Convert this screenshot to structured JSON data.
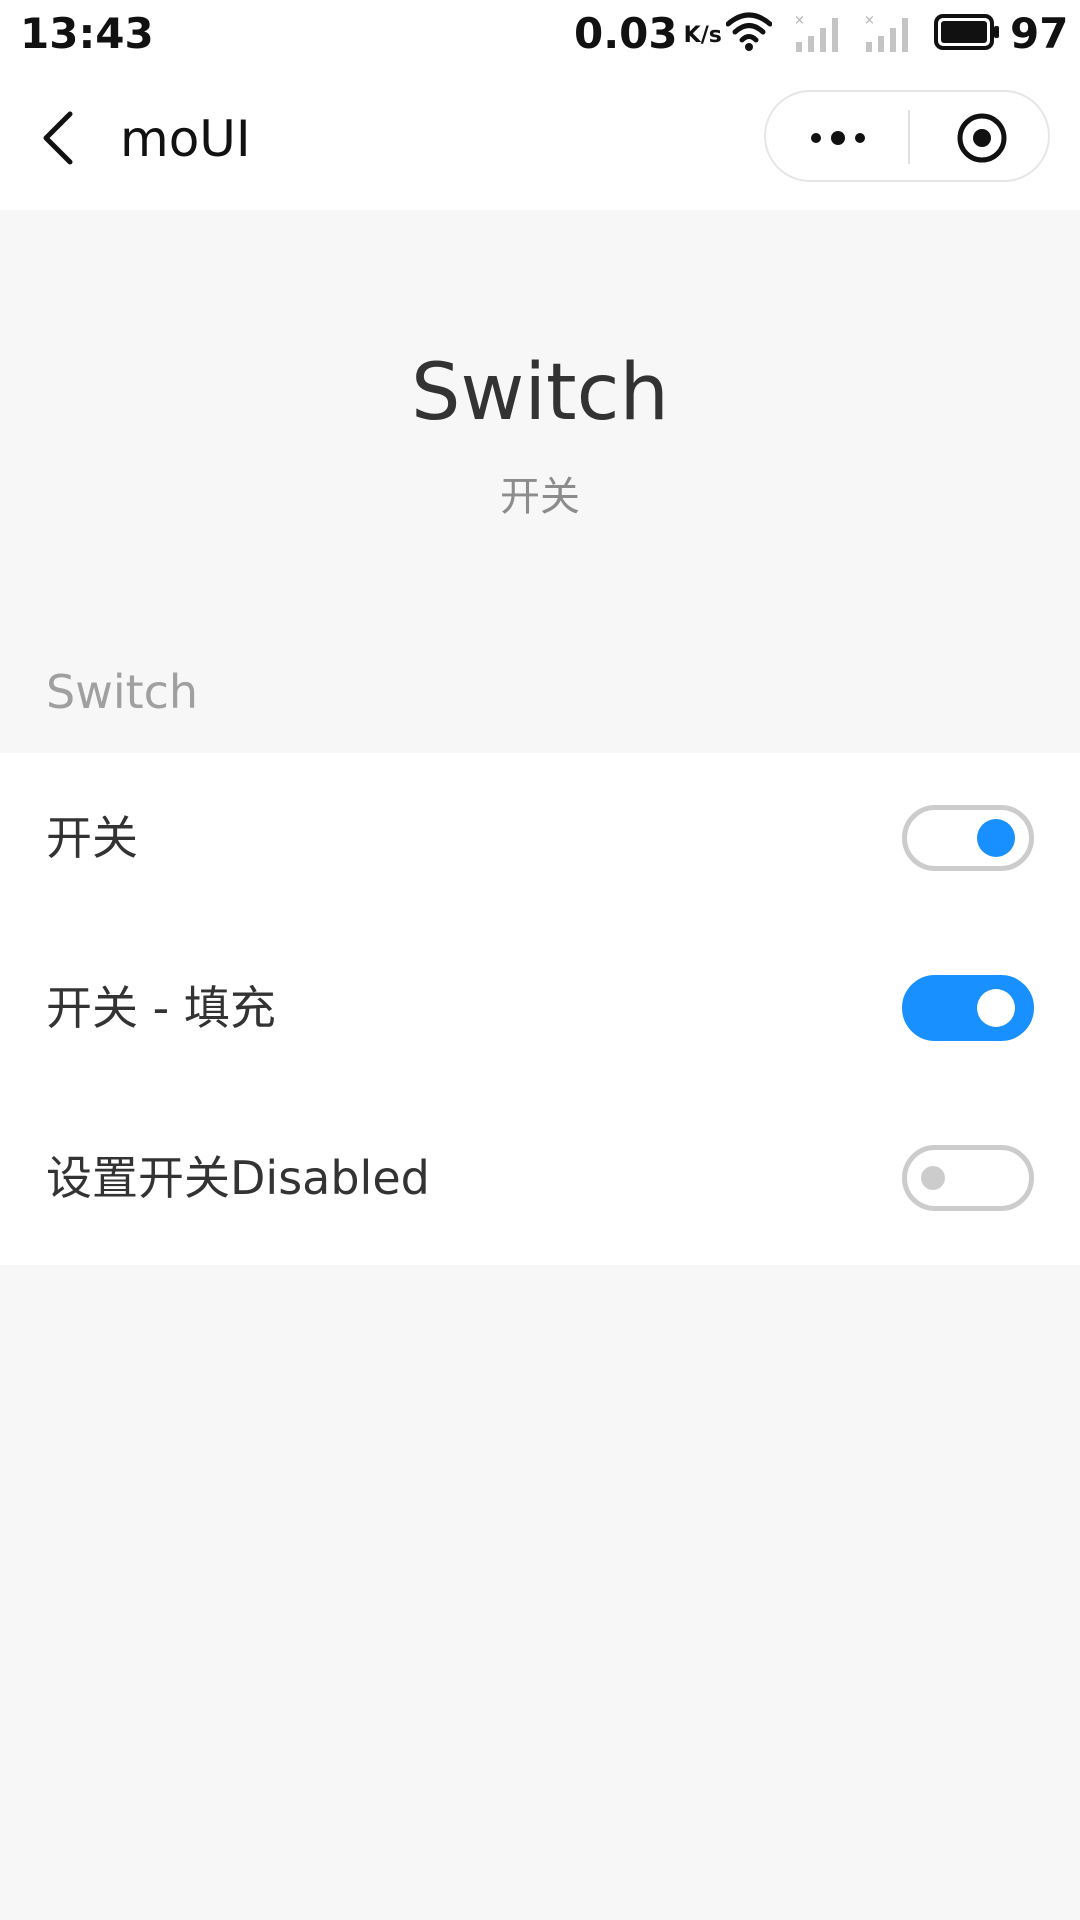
{
  "status_bar": {
    "time": "13:43",
    "network_speed": "0.03",
    "speed_unit": "K/s",
    "battery": "97",
    "icons": [
      "wifi-icon",
      "signal-off-icon",
      "signal-off-icon",
      "battery-icon"
    ]
  },
  "nav": {
    "title": "moUI",
    "icons": [
      "chevron-left-icon",
      "more-icon",
      "target-icon"
    ]
  },
  "header": {
    "title": "Switch",
    "subtitle": "开关"
  },
  "section": {
    "title": "Switch"
  },
  "rows": [
    {
      "label": "开关",
      "checked": true,
      "style": "outline",
      "disabled": false
    },
    {
      "label": "开关 - 填充",
      "checked": true,
      "style": "filled",
      "disabled": false
    },
    {
      "label": "设置开关Disabled",
      "checked": false,
      "style": "outline",
      "disabled": true
    }
  ],
  "colors": {
    "accent": "#1890ff",
    "background": "#f7f7f7",
    "surface": "#ffffff",
    "toggle_border": "#cccccc",
    "text": "#333333",
    "muted_text": "#8c8c8c"
  }
}
